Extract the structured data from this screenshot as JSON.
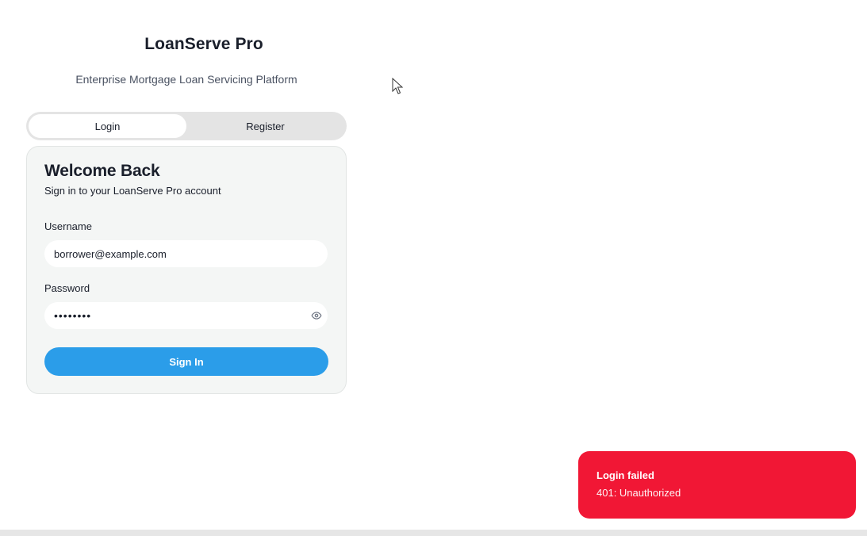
{
  "brand": {
    "title": "LoanServe Pro",
    "subtitle": "Enterprise Mortgage Loan Servicing Platform"
  },
  "tabs": [
    {
      "label": "Login",
      "active": true
    },
    {
      "label": "Register",
      "active": false
    }
  ],
  "login_card": {
    "title": "Welcome Back",
    "subtitle": "Sign in to your LoanServe Pro account",
    "username": {
      "label": "Username",
      "value": "borrower@example.com"
    },
    "password": {
      "label": "Password",
      "masked_value": "••••••••",
      "toggle_icon": "eye-icon"
    },
    "submit_label": "Sign In"
  },
  "toast": {
    "title": "Login failed",
    "message": "401: Unauthorized"
  },
  "colors": {
    "primary": "#2b9de9",
    "error": "#f11735",
    "card_bg": "#f4f6f5",
    "tab_track": "#e4e4e4"
  }
}
